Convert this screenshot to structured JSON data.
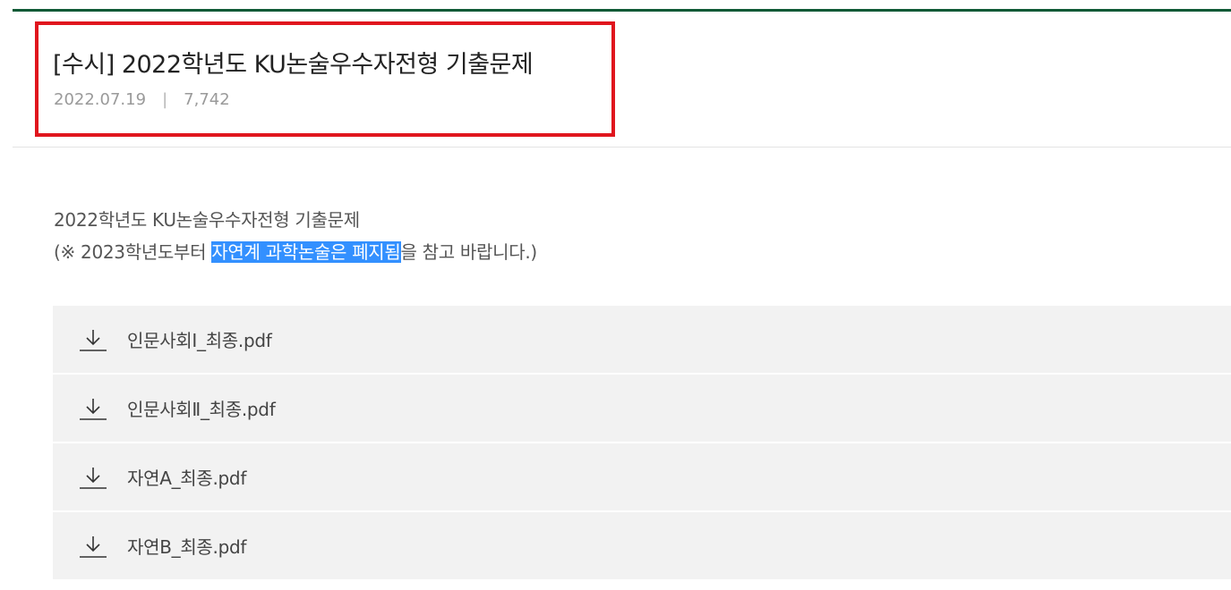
{
  "post": {
    "title": "[수시] 2022학년도 KU논술우수자전형 기출문제",
    "date": "2022.07.19",
    "separator": "|",
    "views": "7,742"
  },
  "content": {
    "line1": "2022학년도 KU논술우수자전형 기출문제",
    "line2_prefix": "(※ 2023학년도부터 ",
    "line2_selected": "자연계 과학논술은 폐지됨",
    "line2_suffix": "을 참고 바랍니다.)"
  },
  "attachments": [
    {
      "icon": "download-icon",
      "name": "인문사회Ⅰ_최종.pdf"
    },
    {
      "icon": "download-icon",
      "name": "인문사회Ⅱ_최종.pdf"
    },
    {
      "icon": "download-icon",
      "name": "자연A_최종.pdf"
    },
    {
      "icon": "download-icon",
      "name": "자연B_최종.pdf"
    }
  ],
  "colors": {
    "accent_rule": "#0f5a36",
    "highlight_box": "#e0161e",
    "selection": "#3390ff",
    "row_background": "#f2f2f2"
  }
}
